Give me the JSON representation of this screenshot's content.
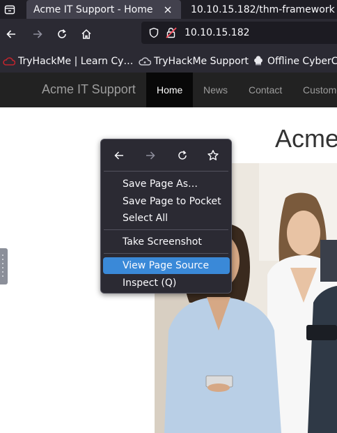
{
  "browser": {
    "tabs": [
      {
        "title": "Acme IT Support - Home",
        "active": true
      },
      {
        "title": "10.10.15.182/thm-framework",
        "active": false
      }
    ],
    "url": "10.10.15.182",
    "bookmarks": [
      {
        "label": "TryHackMe | Learn Cy…",
        "icon": "tryhackme-icon"
      },
      {
        "label": "TryHackMe Support",
        "icon": "support-cloud-icon"
      },
      {
        "label": "Offline CyberCh",
        "icon": "chef-hat-icon"
      }
    ]
  },
  "site": {
    "brand": "Acme IT Support",
    "menu": [
      "Home",
      "News",
      "Contact",
      "Customers"
    ],
    "heading": "Acme"
  },
  "context_menu": {
    "items": [
      {
        "label": "Save Page As…"
      },
      {
        "label": "Save Page to Pocket"
      },
      {
        "label": "Select All"
      },
      {
        "label": "Take Screenshot"
      },
      {
        "label": "View Page Source",
        "highlighted": true
      },
      {
        "label": "Inspect (Q)"
      }
    ]
  },
  "colors": {
    "tab_bar": "#1f1e25",
    "toolbar": "#2b2a33",
    "site_nav": "#222222",
    "menu_highlight": "#3a89d8"
  }
}
